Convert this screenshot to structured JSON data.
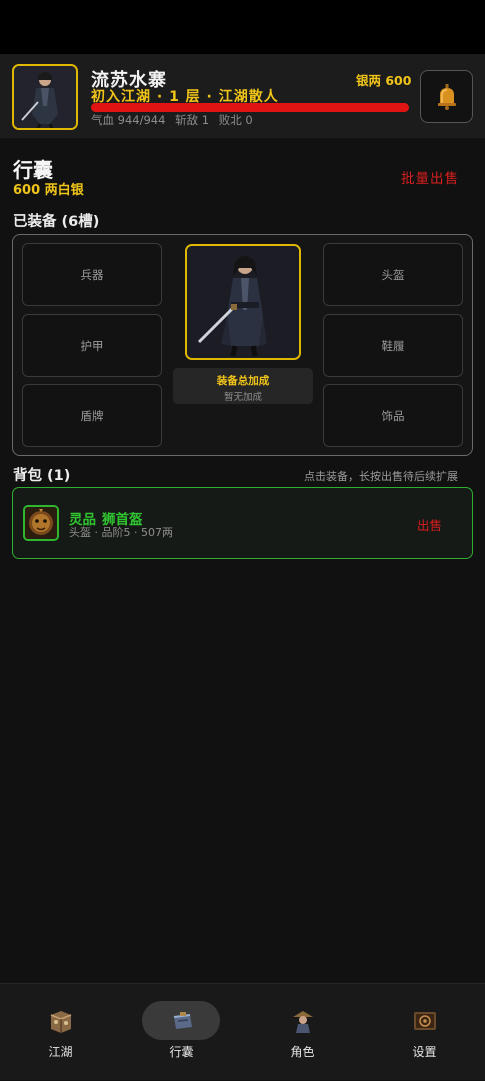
{
  "header": {
    "player_name": "流苏水寨",
    "rank_line": "初入江湖 · 1 层 · 江湖散人",
    "silver_label": "银两 600",
    "hp_label": "气血 944/944",
    "kills_label": "斩敌 1",
    "defeats_label": "败北 0",
    "hp_fraction": 1.0,
    "hp_color": "#e11414",
    "accent_gold": "#f0c419"
  },
  "bag_page": {
    "title": "行囊",
    "silver_amount": "600 两白银",
    "bulk_sell_label": "批量出售"
  },
  "equipment": {
    "title": "已装备 (6槽)",
    "slots": {
      "weapon": "兵器",
      "helmet": "头盔",
      "armor": "护甲",
      "boots": "鞋履",
      "shield": "盾牌",
      "accessory": "饰品"
    },
    "bonus_title": "装备总加成",
    "bonus_sub": "暂无加成"
  },
  "backpack": {
    "title": "背包 (1)",
    "hint": "点击装备，长按出售待后续扩展",
    "items": [
      {
        "quality": "灵品",
        "name": "狮首盔",
        "meta": "头盔 · 品阶5 · 507两",
        "sell_label": "出售",
        "quality_color": "#31c431"
      }
    ]
  },
  "nav": {
    "items": [
      {
        "label": "江湖",
        "icon": "map-icon",
        "active": false
      },
      {
        "label": "行囊",
        "icon": "bag-icon",
        "active": true
      },
      {
        "label": "角色",
        "icon": "character-icon",
        "active": false
      },
      {
        "label": "设置",
        "icon": "settings-scroll-icon",
        "active": false
      }
    ]
  }
}
